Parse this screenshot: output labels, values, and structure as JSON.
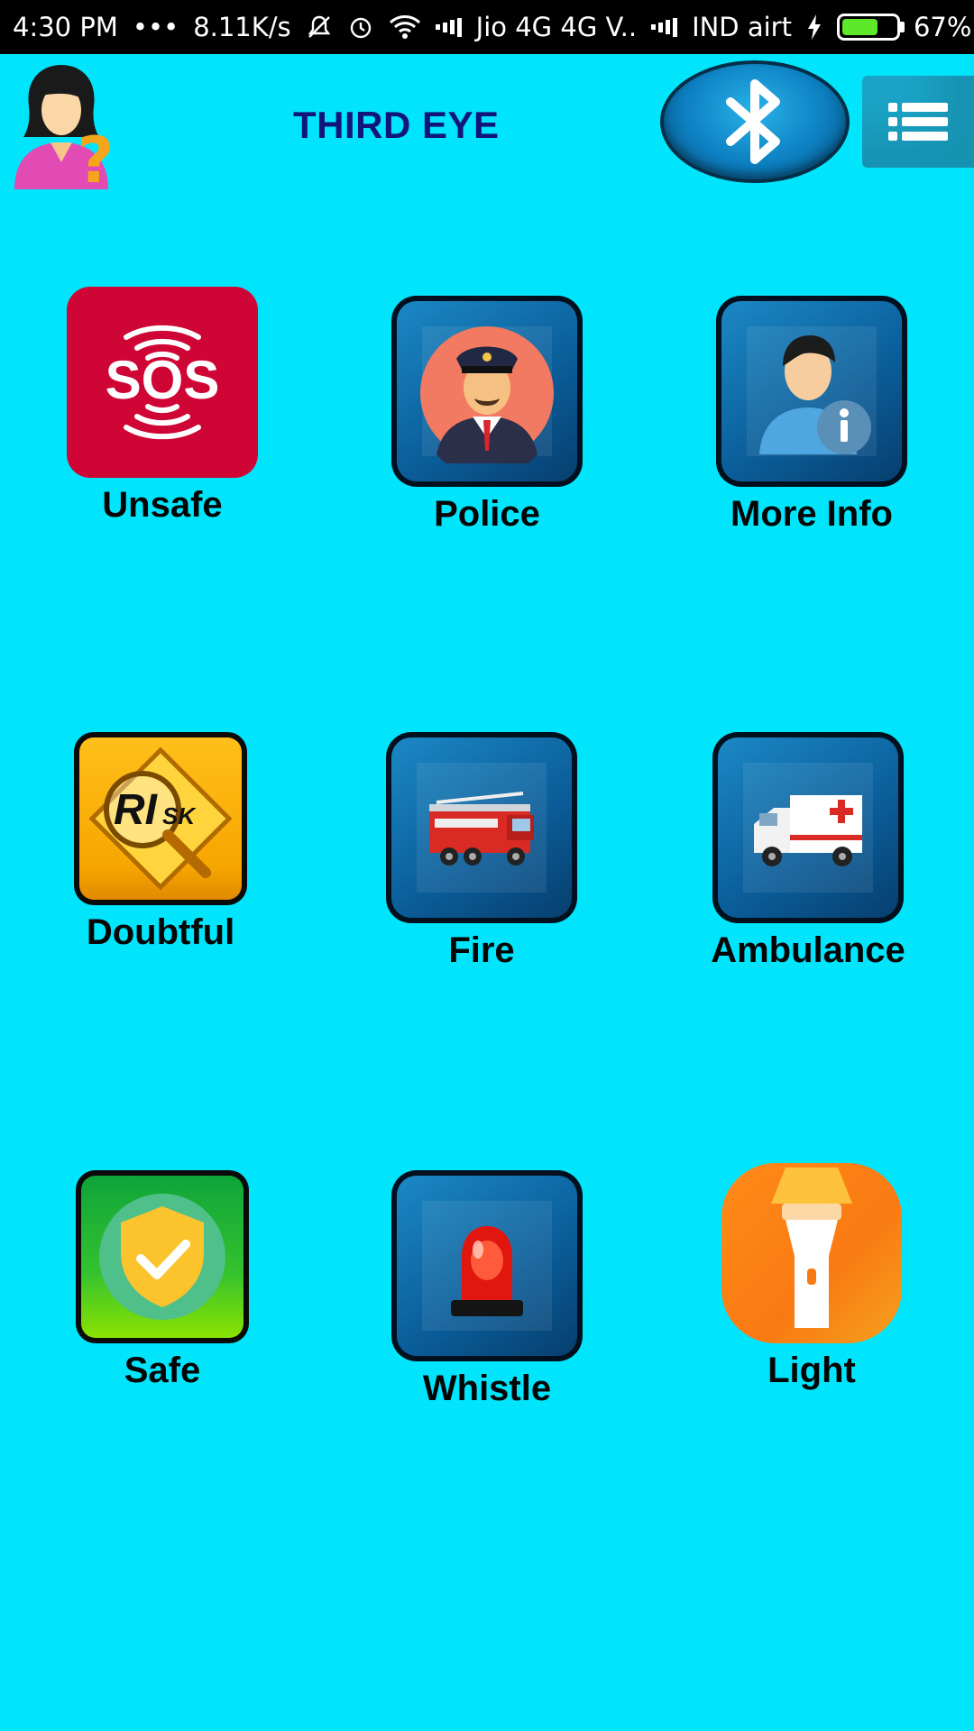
{
  "status_bar": {
    "time": "4:30 PM",
    "dots": "•••",
    "speed": "8.11K/s",
    "carrier1": "Jio 4G 4G",
    "carrier1_suffix": "V..",
    "carrier2": "IND airt",
    "battery": "67%",
    "battery_level": 0.67
  },
  "header": {
    "title": "THIRD EYE",
    "avatar_icon": "woman-question-icon",
    "bluetooth_icon": "bluetooth-icon",
    "menu_icon": "list-menu-icon"
  },
  "tiles": [
    {
      "label": "Unsafe",
      "icon": "sos-icon"
    },
    {
      "label": "Police",
      "icon": "police-officer-icon"
    },
    {
      "label": "More Info",
      "icon": "user-info-icon"
    },
    {
      "label": "Doubtful",
      "icon": "risk-icon"
    },
    {
      "label": "Fire",
      "icon": "fire-truck-icon"
    },
    {
      "label": "Ambulance",
      "icon": "ambulance-icon"
    },
    {
      "label": "Safe",
      "icon": "shield-check-icon"
    },
    {
      "label": "Whistle",
      "icon": "siren-icon"
    },
    {
      "label": "Light",
      "icon": "flashlight-icon"
    }
  ],
  "colors": {
    "background": "#00e5fc",
    "title": "#12167a",
    "sos_red": "#cf0535",
    "frame_blue": "#0a5c98"
  }
}
